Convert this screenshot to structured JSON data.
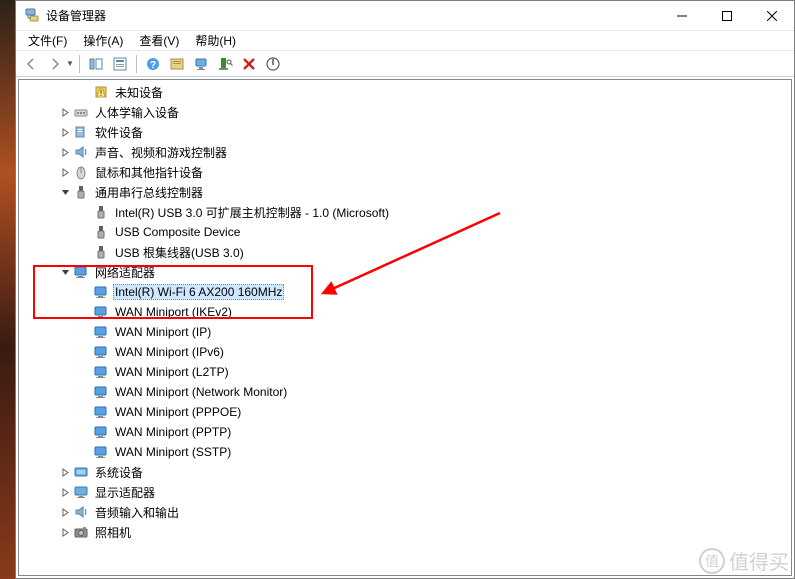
{
  "window": {
    "title": "设备管理器"
  },
  "menu": {
    "file": "文件(F)",
    "action": "操作(A)",
    "view": "查看(V)",
    "help": "帮助(H)"
  },
  "tree": [
    {
      "indent": 2,
      "exp": "",
      "icon": "warn",
      "label": "未知设备"
    },
    {
      "indent": 1,
      "exp": ">",
      "icon": "hid",
      "label": "人体学输入设备"
    },
    {
      "indent": 1,
      "exp": ">",
      "icon": "sw",
      "label": "软件设备"
    },
    {
      "indent": 1,
      "exp": ">",
      "icon": "audio",
      "label": "声音、视频和游戏控制器"
    },
    {
      "indent": 1,
      "exp": ">",
      "icon": "mouse",
      "label": "鼠标和其他指针设备"
    },
    {
      "indent": 1,
      "exp": "v",
      "icon": "usb",
      "label": "通用串行总线控制器"
    },
    {
      "indent": 2,
      "exp": "",
      "icon": "usb",
      "label": "Intel(R) USB 3.0 可扩展主机控制器 - 1.0 (Microsoft)"
    },
    {
      "indent": 2,
      "exp": "",
      "icon": "usb",
      "label": "USB Composite Device"
    },
    {
      "indent": 2,
      "exp": "",
      "icon": "usb",
      "label": "USB 根集线器(USB 3.0)"
    },
    {
      "indent": 1,
      "exp": "v",
      "icon": "net",
      "label": "网络适配器"
    },
    {
      "indent": 2,
      "exp": "",
      "icon": "net",
      "label": "Intel(R) Wi-Fi 6 AX200 160MHz",
      "sel": true
    },
    {
      "indent": 2,
      "exp": "",
      "icon": "net",
      "label": "WAN Miniport (IKEv2)"
    },
    {
      "indent": 2,
      "exp": "",
      "icon": "net",
      "label": "WAN Miniport (IP)"
    },
    {
      "indent": 2,
      "exp": "",
      "icon": "net",
      "label": "WAN Miniport (IPv6)"
    },
    {
      "indent": 2,
      "exp": "",
      "icon": "net",
      "label": "WAN Miniport (L2TP)"
    },
    {
      "indent": 2,
      "exp": "",
      "icon": "net",
      "label": "WAN Miniport (Network Monitor)"
    },
    {
      "indent": 2,
      "exp": "",
      "icon": "net",
      "label": "WAN Miniport (PPPOE)"
    },
    {
      "indent": 2,
      "exp": "",
      "icon": "net",
      "label": "WAN Miniport (PPTP)"
    },
    {
      "indent": 2,
      "exp": "",
      "icon": "net",
      "label": "WAN Miniport (SSTP)"
    },
    {
      "indent": 1,
      "exp": ">",
      "icon": "sys",
      "label": "系统设备"
    },
    {
      "indent": 1,
      "exp": ">",
      "icon": "disp",
      "label": "显示适配器"
    },
    {
      "indent": 1,
      "exp": ">",
      "icon": "audio",
      "label": "音频输入和输出"
    },
    {
      "indent": 1,
      "exp": ">",
      "icon": "cam",
      "label": "照相机"
    }
  ],
  "watermark": {
    "text": "值得买",
    "icon": "值"
  }
}
